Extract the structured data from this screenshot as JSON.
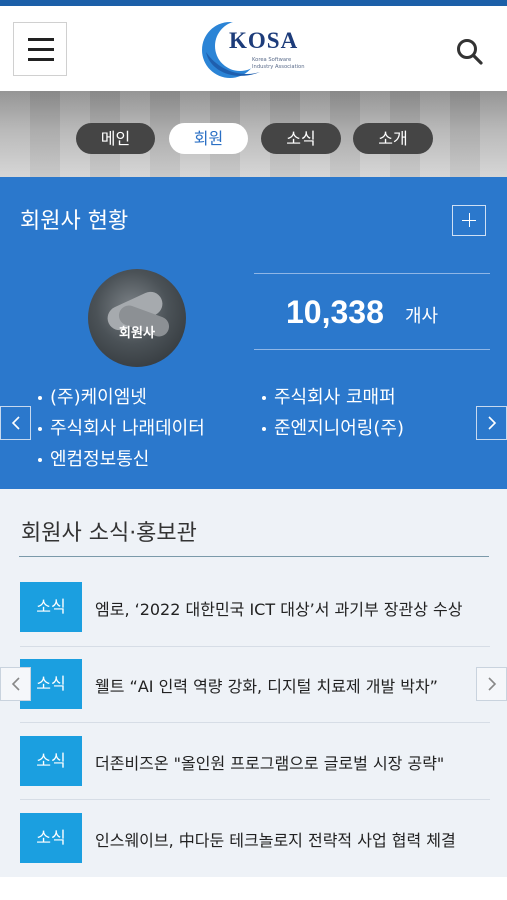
{
  "header": {
    "logo_text": "KOSA",
    "logo_sub_line1": "Korea Software",
    "logo_sub_line2": "Industry Association"
  },
  "tabs": [
    {
      "label": "메인",
      "active": false
    },
    {
      "label": "회원",
      "active": true
    },
    {
      "label": "소식",
      "active": false
    },
    {
      "label": "소개",
      "active": false
    }
  ],
  "members": {
    "title": "회원사 현황",
    "avatar_label": "회원사",
    "count": "10,338",
    "count_unit": "개사",
    "list": [
      "(주)케이엠넷",
      "주식회사 코매퍼",
      "주식회사 나래데이터",
      "준엔지니어링(주)",
      "엔컴정보통신"
    ]
  },
  "news": {
    "title": "회원사 소식·홍보관",
    "items": [
      {
        "badge": "소식",
        "text": "엠로, ‘2022 대한민국 ICT 대상’서 과기부 장관상 수상"
      },
      {
        "badge": "소식",
        "text": "웰트 “AI 인력 역량 강화, 디지털 치료제 개발 박차”"
      },
      {
        "badge": "소식",
        "text": "더존비즈온 \"올인원 프로그램으로 글로벌 시장 공략\""
      },
      {
        "badge": "소식",
        "text": "인스웨이브, 中다둔 테크놀로지 전략적 사업 협력 체결"
      }
    ]
  },
  "colors": {
    "brand_blue": "#2b78cc",
    "top_bar": "#1c5fa8",
    "badge_blue": "#1b9fe0",
    "active_tab_text": "#2a6fc4"
  },
  "icons": {
    "menu": "hamburger-icon",
    "search": "search-icon",
    "plus": "plus-icon",
    "prev": "chevron-left-icon",
    "next": "chevron-right-icon"
  }
}
